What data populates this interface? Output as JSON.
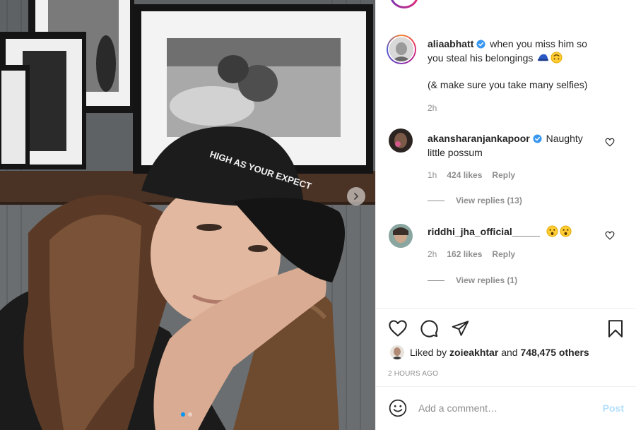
{
  "post": {
    "author": "aliaabhatt",
    "caption_line1": "when you miss him so",
    "caption_line2": "you steal his belongings",
    "caption_line3": "(& make sure you take many selfies)",
    "time": "2h",
    "photo_text": "HIGH AS YOUR EXPECT",
    "carousel_count": 2,
    "carousel_active": 1
  },
  "comments": [
    {
      "username": "akansharanjankapoor",
      "text_line1": "Naughty",
      "text_line2": "little possum",
      "time": "1h",
      "likes": "424 likes",
      "reply_label": "Reply",
      "view_replies": "View replies (13)"
    },
    {
      "username": "riddhi_jha_official_____",
      "text": "",
      "time": "2h",
      "likes": "162 likes",
      "reply_label": "Reply",
      "view_replies": "View replies (1)"
    }
  ],
  "likes": {
    "prefix": "Liked by",
    "user": "zoieakhtar",
    "conjunction": "and",
    "others": "748,475 others"
  },
  "timeago": "2 HOURS AGO",
  "add_comment": {
    "placeholder": "Add a comment…",
    "post_label": "Post"
  },
  "icons": {
    "verified": "verified-badge-icon",
    "heart": "heart-icon",
    "comment": "comment-icon",
    "share": "paper-plane-icon",
    "save": "bookmark-icon",
    "emoji": "smiley-icon",
    "next": "chevron-right-icon"
  },
  "colors": {
    "accent": "#0095f6",
    "verified": "#3897f0",
    "muted": "#8e8e8e",
    "post_disabled": "#b2dffc"
  }
}
